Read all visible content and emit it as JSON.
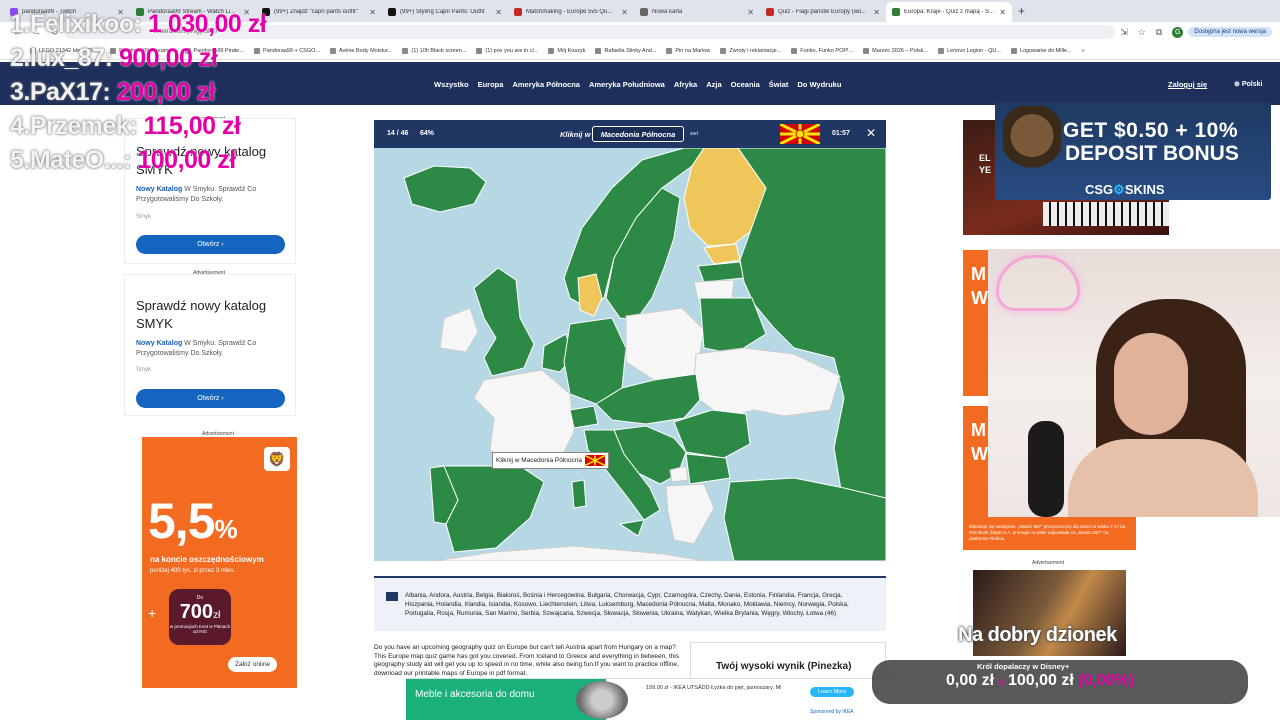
{
  "browser": {
    "tabs": [
      {
        "title": "pandoraa99 - Twitch",
        "color": "#9146ff",
        "active": false
      },
      {
        "title": "Pandoraa99 Stream - Watch Li...",
        "color": "#2e7d32",
        "active": false
      },
      {
        "title": "(99+) Znajdź \"capri pants outfit\"",
        "color": "#111111",
        "active": false
      },
      {
        "title": "(99+) Styling Capri Pants: Outfit",
        "color": "#111111",
        "active": false
      },
      {
        "title": "Matchmaking - Europe 5v5 Qu...",
        "color": "#c62828",
        "active": false
      },
      {
        "title": "Nowa karta",
        "color": "#666666",
        "active": false
      },
      {
        "title": "Quiz - Flagi państw Europy (wo...",
        "color": "#c62828",
        "active": false
      },
      {
        "title": "Europa: Kraje - Quiz z mapą - S...",
        "color": "#2e7d32",
        "active": true
      }
    ],
    "url": "seterra.com/pl/vgp/3007",
    "profile_initial": "G",
    "update_label": "Dostępna jest nowa wersja",
    "bookmarks": [
      "LEGO 21342 Ideas Ow...",
      "Pandoraa99 Stream ...",
      "Pandoraa99 Pirate...",
      "Pandoraa99 + CSGO...",
      "Avène Body Moistur...",
      "(1) 10h Black screen...",
      "(1) pov you are in cl...",
      "Mój Koszyk",
      "Rafaella Slinky And...",
      "Pin na Marlow",
      "Zwroty i reklamacje...",
      "Funko, Funko POP!...",
      "Marzec 2026 – Polsk...",
      "Lenovo Legion - QU...",
      "Logowanie do Mille..."
    ],
    "bookmarks_more": "»"
  },
  "site": {
    "nav": [
      "Wszystko",
      "Europa",
      "Ameryka Północna",
      "Ameryka Południowa",
      "Afryka",
      "Azja",
      "Oceania",
      "Świat",
      "Do Wydruku"
    ],
    "login": "Zaloguj się",
    "language": "Polski"
  },
  "ads_left": {
    "label": "Advertisement",
    "card1": {
      "title": "Sprawdź nowy katalog SMYK",
      "brand_link": "Nowy Katalog",
      "desc": "W Smyku. Sprawdź Co Przygotowaliśmy Do Szkoły.",
      "brand": "Smyk",
      "button": "Otwórz"
    },
    "card2": {
      "title": "Sprawdź nowy katalog SMYK",
      "brand_link": "Nowy Katalog",
      "desc": "W Smyku. Sprawdź Co Przygotowaliśmy Do Szkoły.",
      "brand": "Smyk",
      "button": "Otwórz"
    },
    "ing": {
      "rate": "5,5",
      "pct": "%",
      "line1": "na koncie oszczędnościowym",
      "line2": "poniżej 400 tys. zł przez 3 mies.",
      "plus": "+",
      "bubble_pre": "Do",
      "bubble_amount": "700",
      "bubble_unit": "zł",
      "bubble_text": "w promocjach Kont w Planach od ING",
      "cta": "Załóż online"
    }
  },
  "quiz": {
    "count": "14 / 46",
    "percent": "64%",
    "prompt": "Kliknij w",
    "target": "Macedonia Północna",
    "timer": "01:57",
    "tooltip": "Kliknij w Macedonia Północna",
    "countries_list": "Albania, Andora, Austria, Belgia, Białoruś, Bośnia i Hercegowina, Bułgaria, Chorwacja, Cypr, Czarnogóra, Czechy, Dania, Estonia, Finlandia, Francja, Grecja, Hiszpania, Holandia, Irlandia, Islandia, Kosowo, Liechtenstein, Litwa, Luksemburg, Macedonia Północna, Malta, Monako, Mołdawia, Niemcy, Norwegia, Polska, Portugalia, Rosja, Rumunia, San Marino, Serbia, Szwajcaria, Szwecja, Słowacja, Słowenia, Ukraina, Watykan, Wielka Brytania, Węgry, Włochy, Łotwa (46)",
    "description": "Do you have an upcoming geography quiz on Europe but can't tell Austria apart from Hungary on a map? This Europe map quiz game has got you covered. From Iceland to Greece and everything in between, this geography study aid will get you up to speed in no time, while also being fun.If you want to practice offline, download our printable maps of Europe in pdf format.",
    "high_score": "Twój wysoki wynik (Pinezka)",
    "colors": {
      "sea": "#b6d8e4",
      "correct": "#2d8a46",
      "wrong": "#eec65a",
      "remaining": "#f6f6f6",
      "outline": "#ffffff"
    }
  },
  "bottom_ad": {
    "title": "Meble i akcesoria do domu",
    "text": "199,00 zł - IKEA UTSÄDD Łyżka do pięt, jasnoszary. Mi",
    "button": "Learn More",
    "sponsor": "Sponsored by IKEA"
  },
  "ads_right": {
    "ad1_text": "EL\nYE",
    "ad2_big1": "M",
    "ad2_big2": "W",
    "ad3_big1": "M",
    "ad3_big2": "W",
    "ad3_fine": "Bilansuje się następnie: „Maxim 867\" przeznaczony dla dzieci w wieku 7-17 lat. ING Bank Śląski S.A. promuje i w pełni odpowiada na „Maxim 867\" na platformie Roblox.",
    "label": "Advertisement"
  },
  "stream": {
    "leaderboard": [
      {
        "name": "1.Felixikoo:",
        "amount": "1 030,00 zł"
      },
      {
        "name": "2.lux_87:",
        "amount": "900,00 zł"
      },
      {
        "name": "3.PaX17:",
        "amount": "200,00 zł"
      },
      {
        "name": "4.Przemek:",
        "amount": "115,00 zł"
      },
      {
        "name": "5.MateO...:",
        "amount": "100,00 zł"
      }
    ],
    "promo": {
      "line1": "GET $0.50 + 10%",
      "line2": "DEPOSIT BONUS",
      "brand_a": "CSG",
      "brand_b": "SKINS"
    },
    "greeting": "Na dobry dzionek",
    "goal": {
      "title": "Król dopalaczy w Disney+",
      "current": "0,00 zł",
      "separator": "z",
      "target": "100,00 zł",
      "percent": "(0,00%)"
    }
  }
}
